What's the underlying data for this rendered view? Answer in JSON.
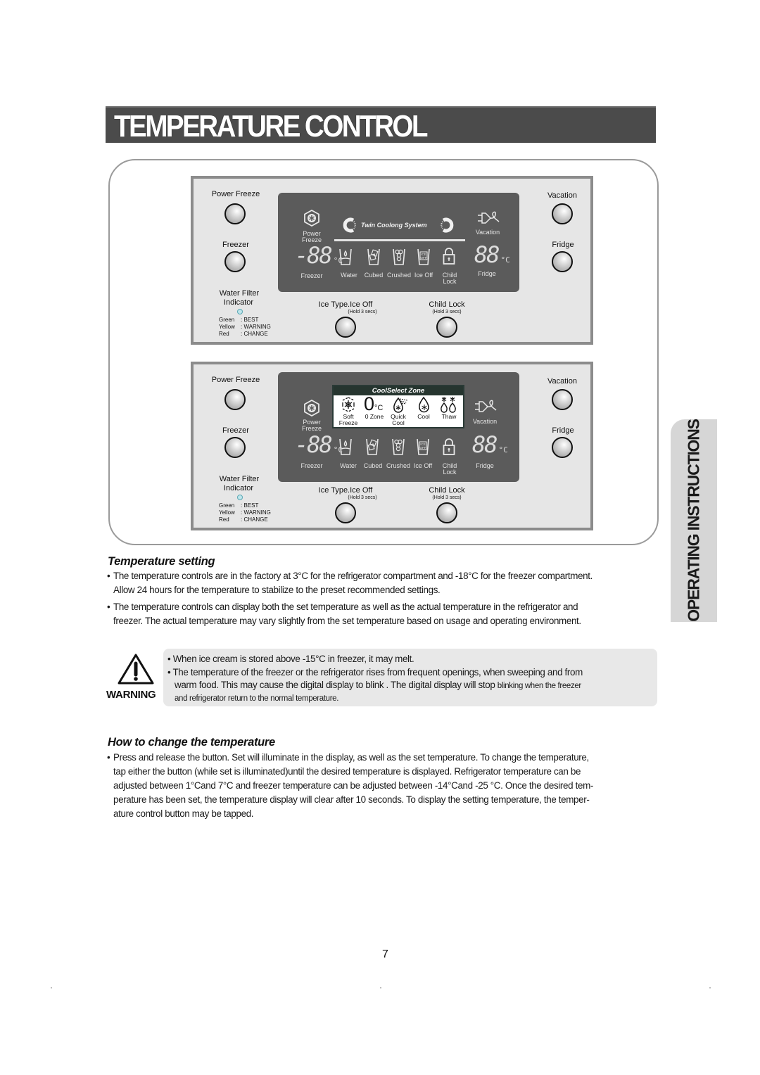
{
  "page": {
    "title": "TEMPERATURE CONTROL",
    "side_tab": "OPERATING INSTRUCTIONS",
    "page_number": "7"
  },
  "panel_common": {
    "buttons": {
      "power_freeze": "Power Freeze",
      "freezer": "Freezer",
      "vacation": "Vacation",
      "fridge": "Fridge",
      "ice_type": "Ice Type.Ice Off",
      "child_lock": "Child Lock",
      "hold": "(Hold 3 secs)"
    },
    "water_filter": {
      "title_line1": "Water Filter",
      "title_line2": "Indicator",
      "legend": [
        {
          "color": "Green",
          "meaning": ": BEST"
        },
        {
          "color": "Yellow",
          "meaning": ": WARNING"
        },
        {
          "color": "Red",
          "meaning": ": CHANGE"
        }
      ]
    },
    "display": {
      "power_freeze_l1": "Power",
      "power_freeze_l2": "Freeze",
      "freezer_digits": "-88",
      "fridge_digits": "88",
      "unit": "°C",
      "freezer": "Freezer",
      "fridge": "Fridge",
      "vacation": "Vacation",
      "water": "Water",
      "cubed": "Cubed",
      "crushed": "Crushed",
      "ice_off": "Ice Off",
      "ice_off_icon_l1": "ICE",
      "ice_off_icon_l2": "OFF",
      "child_l1": "Child",
      "child_l2": "Lock"
    }
  },
  "panel1": {
    "system_label": "Twin Coolong System"
  },
  "panel2": {
    "coolselect": {
      "header": "CoolSelect Zone",
      "zero_digit": "0",
      "zero_unit": "°C",
      "items": [
        {
          "l1": "Soft",
          "l2": "Freeze"
        },
        {
          "l1": "0 Zone",
          "l2": ""
        },
        {
          "l1": "Quick",
          "l2": "Cool"
        },
        {
          "l1": "Cool",
          "l2": ""
        },
        {
          "l1": "Thaw",
          "l2": ""
        }
      ]
    }
  },
  "temperature_setting": {
    "heading": "Temperature setting",
    "bullets": [
      {
        "l1": "The temperature controls are in the factory at 3°C for the refrigerator compartment and -18°C for the freezer compartment.",
        "l2": "Allow 24 hours for the temperature to stabilize to the preset recommended settings."
      },
      {
        "l1": "The temperature controls can display both the set temperature as well as the actual temperature in the refrigerator and",
        "l2": "freezer. The actual temperature may vary slightly from the set temperature based on usage and operating environment."
      }
    ]
  },
  "warning": {
    "label": "WARNING",
    "b1": "• When ice cream is stored above -15°C in freezer, it may melt.",
    "b2_l1": "• The temperature of the freezer or the refrigerator rises from frequent openings, when sweeping and from",
    "b2_l2a": "warm food. This may cause the digital display to blink . The digital display will stop ",
    "b2_l2b": "blinking when the freezer",
    "b2_l3": "and refrigerator return to the normal temperature."
  },
  "change_temperature": {
    "heading": "How to change the temperature",
    "lines": [
      "Press and release the button. Set will illuminate in the display, as well as the set temperature. To change the temperature,",
      "tap either the button (while set is illuminated)until the desired temperature is displayed. Refrigerator temperature can be",
      "adjusted between 1°Cand 7°C and freezer temperature can be adjusted between -14°Cand -25 °C. Once the desired tem-",
      "perature has been set, the temperature display will clear after 10 seconds. To display the setting temperature, the temper-",
      "ature control button may be tapped."
    ]
  }
}
